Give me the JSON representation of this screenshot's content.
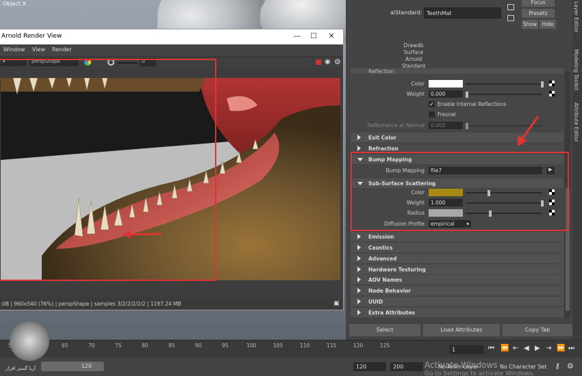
{
  "viewport": {
    "label": "Object X"
  },
  "render_window": {
    "title": "Arnold Render View",
    "menu": [
      "Window",
      "View",
      "Render"
    ],
    "camera": "perspShape",
    "exposure": "0",
    "status": ":08 | 960x540 (76%) | perspShape | samples 3/2/2/2/2/2 | 1197.24 MB"
  },
  "attribute_editor": {
    "node_label": "aiStandard:",
    "node_value": "TeethMat",
    "buttons": {
      "focus": "Focus",
      "presets": "Presets",
      "show": "Show",
      "hide": "Hide"
    },
    "description": [
      "Drawdb",
      "Surface",
      "Arnold",
      "Standard"
    ],
    "side_tabs": [
      "Modeling Toolkit",
      "Attribute Editor",
      "Layer Editor"
    ],
    "reflection": {
      "title": "Reflection",
      "color_label": "Color",
      "weight_label": "Weight",
      "weight_value": "0.000",
      "internal_label": "Enable Internal Reflections",
      "internal_checked": true,
      "fresnel_label": "Fresnel",
      "fresnel_checked": false,
      "rnormal_label": "Reflectance at Normal",
      "rnormal_value": "0.000"
    },
    "sections_before": [
      "Exit Color",
      "Refraction"
    ],
    "bump": {
      "title": "Bump Mapping",
      "label": "Bump Mapping",
      "value": "file7"
    },
    "sss": {
      "title": "Sub-Surface Scattering",
      "color_label": "Color",
      "color": "#a88a12",
      "weight_label": "Weight",
      "weight_value": "1.000",
      "radius_label": "Radius",
      "profile_label": "Diffusion Profile",
      "profile_value": "empirical"
    },
    "sections_after": [
      "Emission",
      "Caustics",
      "Advanced",
      "Hardware Texturing",
      "AOV Names",
      "Node Behavior",
      "UUID",
      "Extra Attributes"
    ],
    "bottom_buttons": [
      "Select",
      "Load Attributes",
      "Copy Tab"
    ]
  },
  "timeline": {
    "ticks": [
      "55",
      "60",
      "65",
      "70",
      "75",
      "80",
      "85",
      "90",
      "95",
      "100",
      "105",
      "110",
      "115",
      "120",
      "125"
    ],
    "current_frame": "1",
    "range_end": "120",
    "range_start_field": "120",
    "range_end_field": "200",
    "anim_layer": "No Anim Layer",
    "char_set": "No Character Set"
  },
  "watermark": {
    "line1": "Activate Windows",
    "line2": "Go to Settings to activate Windows."
  },
  "logo_text": "آریا گستر افزار"
}
